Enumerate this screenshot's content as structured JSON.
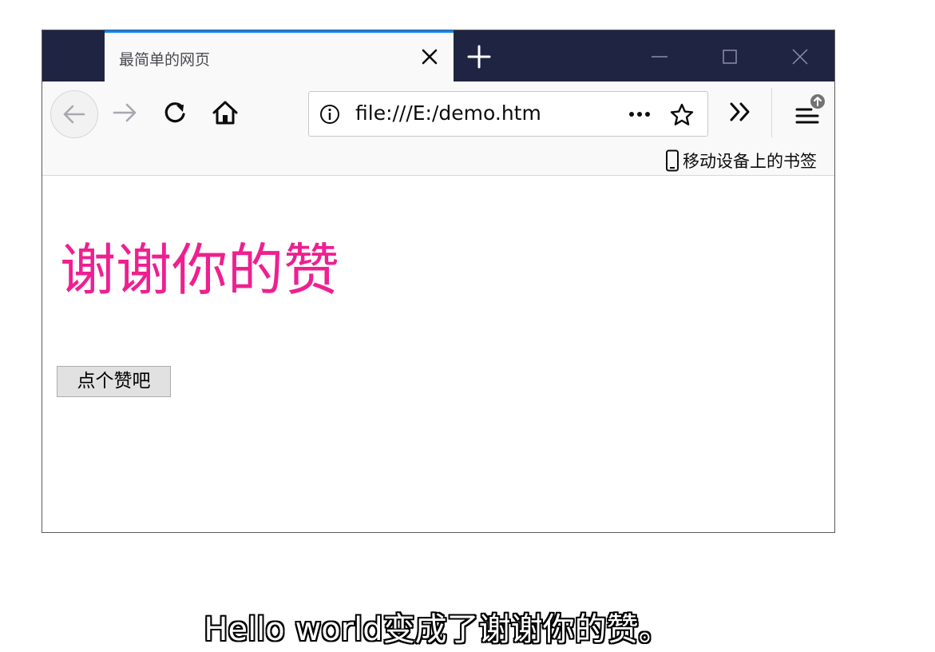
{
  "browser": {
    "tab": {
      "title": "最简单的网页"
    },
    "url": "file:///E:/demo.htm",
    "bookmarks_toolbar": {
      "mobile_bookmarks_label": "移动设备上的书签"
    },
    "accent_color": "#0a84ff",
    "titlebar_color": "#202443"
  },
  "page": {
    "heading": "谢谢你的赞",
    "heading_color": "#ee2090",
    "button_label": "点个赞吧"
  },
  "caption": "Hello world变成了谢谢你的赞。"
}
